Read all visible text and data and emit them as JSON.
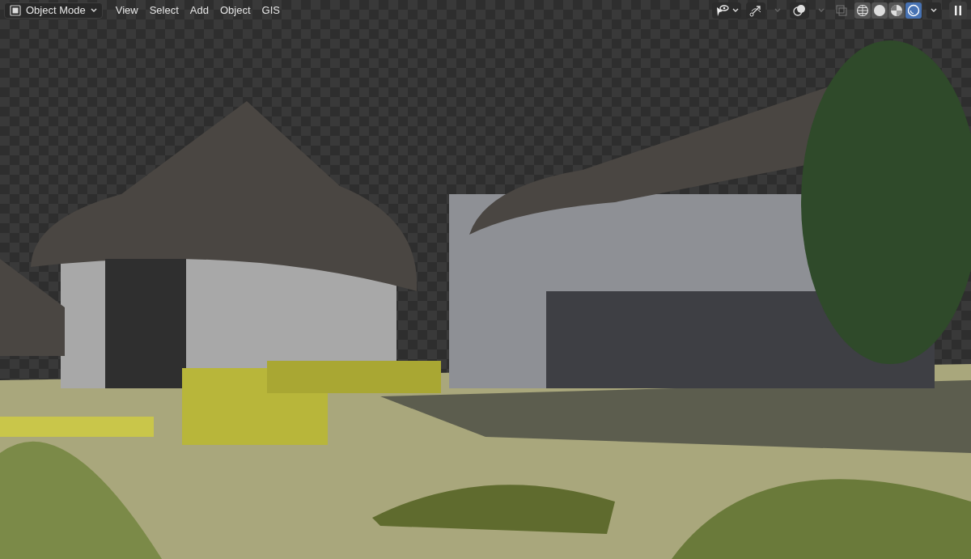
{
  "header": {
    "mode": {
      "label": "Object Mode"
    },
    "menus": [
      "View",
      "Select",
      "Add",
      "Object",
      "GIS"
    ],
    "shading_modes": [
      {
        "kind": "wireframe",
        "selected": false
      },
      {
        "kind": "solid",
        "selected": false
      },
      {
        "kind": "material",
        "selected": false
      },
      {
        "kind": "rendered",
        "selected": true
      }
    ]
  }
}
